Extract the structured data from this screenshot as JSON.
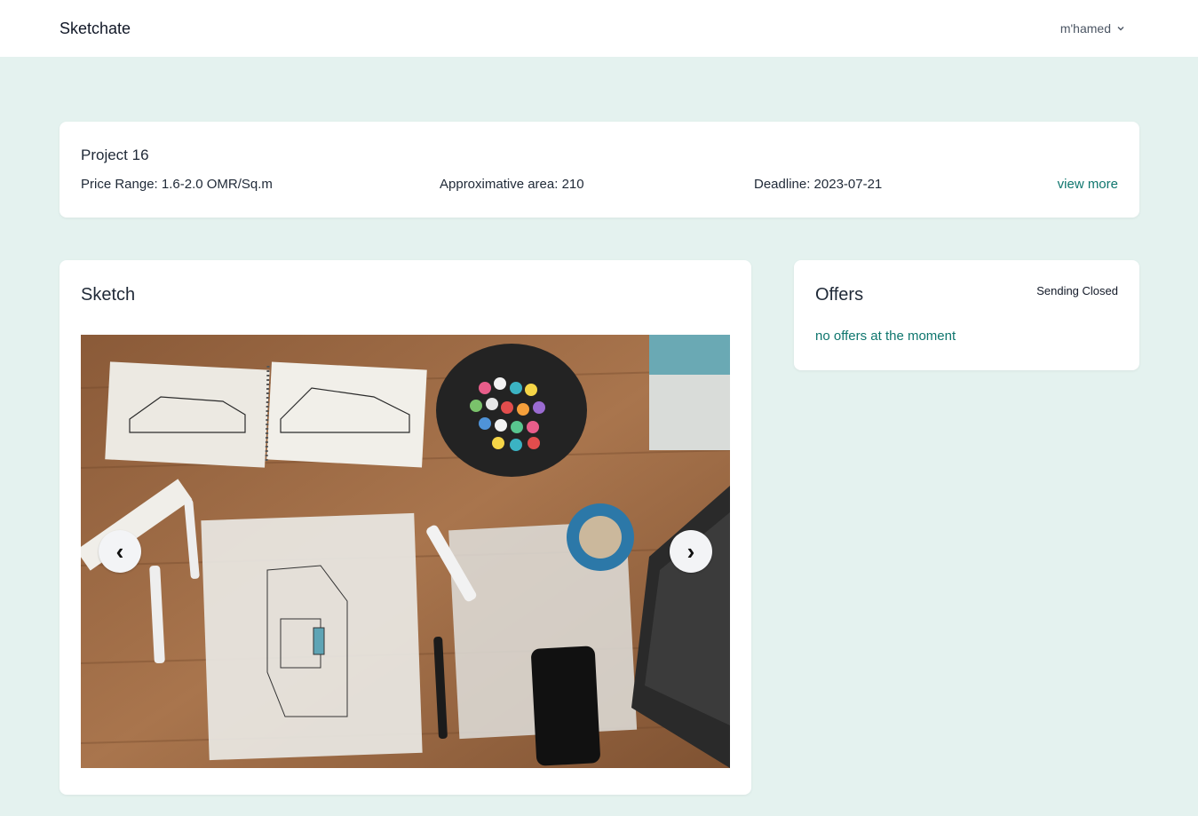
{
  "header": {
    "brand": "Sketchate",
    "user_name": "m'hamed"
  },
  "project": {
    "title": "Project 16",
    "price_range": "Price Range: 1.6-2.0 OMR/Sq.m",
    "area": "Approximative area: 210",
    "deadline": "Deadline: 2023-07-21",
    "view_more": "view more"
  },
  "sketch": {
    "title": "Sketch",
    "prev_label": "‹",
    "next_label": "›",
    "image_alt": "Desk with architecture sketches, markers, tape, phone and laptop"
  },
  "offers": {
    "title": "Offers",
    "status": "Sending Closed",
    "empty_message": "no offers at the moment"
  },
  "colors": {
    "accent": "#0f766e",
    "background": "#e4f2ef"
  },
  "icons": {
    "user_menu": "chevron-down-icon",
    "prev": "chevron-left-icon",
    "next": "chevron-right-icon"
  }
}
